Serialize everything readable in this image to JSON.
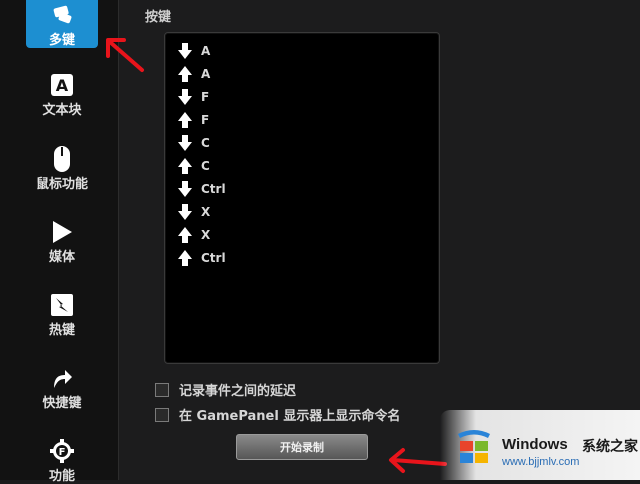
{
  "sidebar": {
    "items": [
      {
        "label": "多键",
        "icon": "multikey-icon",
        "active": true
      },
      {
        "label": "文本块",
        "icon": "letter-a-icon"
      },
      {
        "label": "鼠标功能",
        "icon": "mouse-icon"
      },
      {
        "label": "媒体",
        "icon": "play-icon"
      },
      {
        "label": "热键",
        "icon": "hotkey-icon"
      },
      {
        "label": "快捷键",
        "icon": "shortcut-arrow-icon"
      },
      {
        "label": "功能",
        "icon": "function-gear-icon"
      }
    ]
  },
  "main": {
    "section_label": "按键",
    "keys": [
      {
        "dir": "down",
        "key": "A"
      },
      {
        "dir": "up",
        "key": "A"
      },
      {
        "dir": "down",
        "key": "F"
      },
      {
        "dir": "up",
        "key": "F"
      },
      {
        "dir": "down",
        "key": "C"
      },
      {
        "dir": "up",
        "key": "C"
      },
      {
        "dir": "down",
        "key": "Ctrl"
      },
      {
        "dir": "down",
        "key": "X"
      },
      {
        "dir": "up",
        "key": "X"
      },
      {
        "dir": "up",
        "key": "Ctrl"
      }
    ],
    "options": [
      {
        "label": "记录事件之间的延迟",
        "checked": false
      },
      {
        "label": "在 GamePanel 显示器上显示命令名",
        "checked": false
      }
    ],
    "record_button": "开始录制"
  },
  "watermark": {
    "title": "Windows",
    "title2": "系统之家",
    "url": "www.bjjmlv.com"
  },
  "colors": {
    "active_blue": "#1d8fd1",
    "annotation_red": "#e8141b"
  }
}
